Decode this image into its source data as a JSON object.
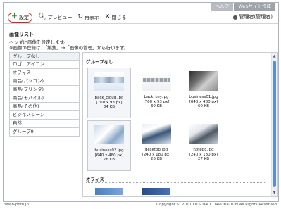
{
  "top_tabs": [
    "ヘルプ",
    "Webサイト作成"
  ],
  "toolbar": {
    "settings_label": "設定",
    "settings_icon": "plus-icon",
    "preview_label": "プレビュー",
    "preview_icon": "search-icon",
    "reload_label": "再表示",
    "reload_icon": "refresh-icon",
    "close_label": "閉じる",
    "close_icon": "close-icon"
  },
  "user": {
    "label": "管理者(管理者)",
    "icon": "person-icon"
  },
  "page": {
    "title": "画像リスト",
    "desc1": "ヘッダに画像を設定します。",
    "desc2": "※画像の登録は、「編集」→「画像の管理」から行います。"
  },
  "sidebar": {
    "items": [
      "グループなし",
      "ロゴ、アイコン",
      "オフィス",
      "商品(パソコン)",
      "商品(プリンタ)",
      "商品(モバイル)",
      "商品(その他)",
      "ビジネスシーン",
      "自然",
      "グループ9"
    ],
    "selected_index": 0
  },
  "groups": [
    {
      "name": "グループなし",
      "images": [
        {
          "file": "back_cloud.jpg",
          "dims": "[760 x 93 px]",
          "size": "34 KB"
        },
        {
          "file": "back_key.jpg",
          "dims": "[760 x 93 px]",
          "size": "30 KB"
        },
        {
          "file": "business01.jpg",
          "dims": "[640 x 480 px]",
          "size": "60 KB"
        },
        {
          "file": "business02.jpg",
          "dims": "[640 x 480 px]",
          "size": "76 KB"
        },
        {
          "file": "desktop.jpg",
          "dims": "[240 x 180 px]",
          "size": "26 KB"
        },
        {
          "file": "notepc.jpg",
          "dims": "[240 x 180 px]",
          "size": "27 KB"
        }
      ]
    },
    {
      "name": "オフィス",
      "images": []
    }
  ],
  "footer": {
    "left": "nweb-pnm.jp",
    "right": "Copyright © 2011 OTSUKA CORPORATION All Rights Reserved"
  },
  "colors": {
    "settings_ring": "#e02020",
    "scroll_thumb": "#5a8fd6",
    "frame_border": "#a9b2bd"
  }
}
